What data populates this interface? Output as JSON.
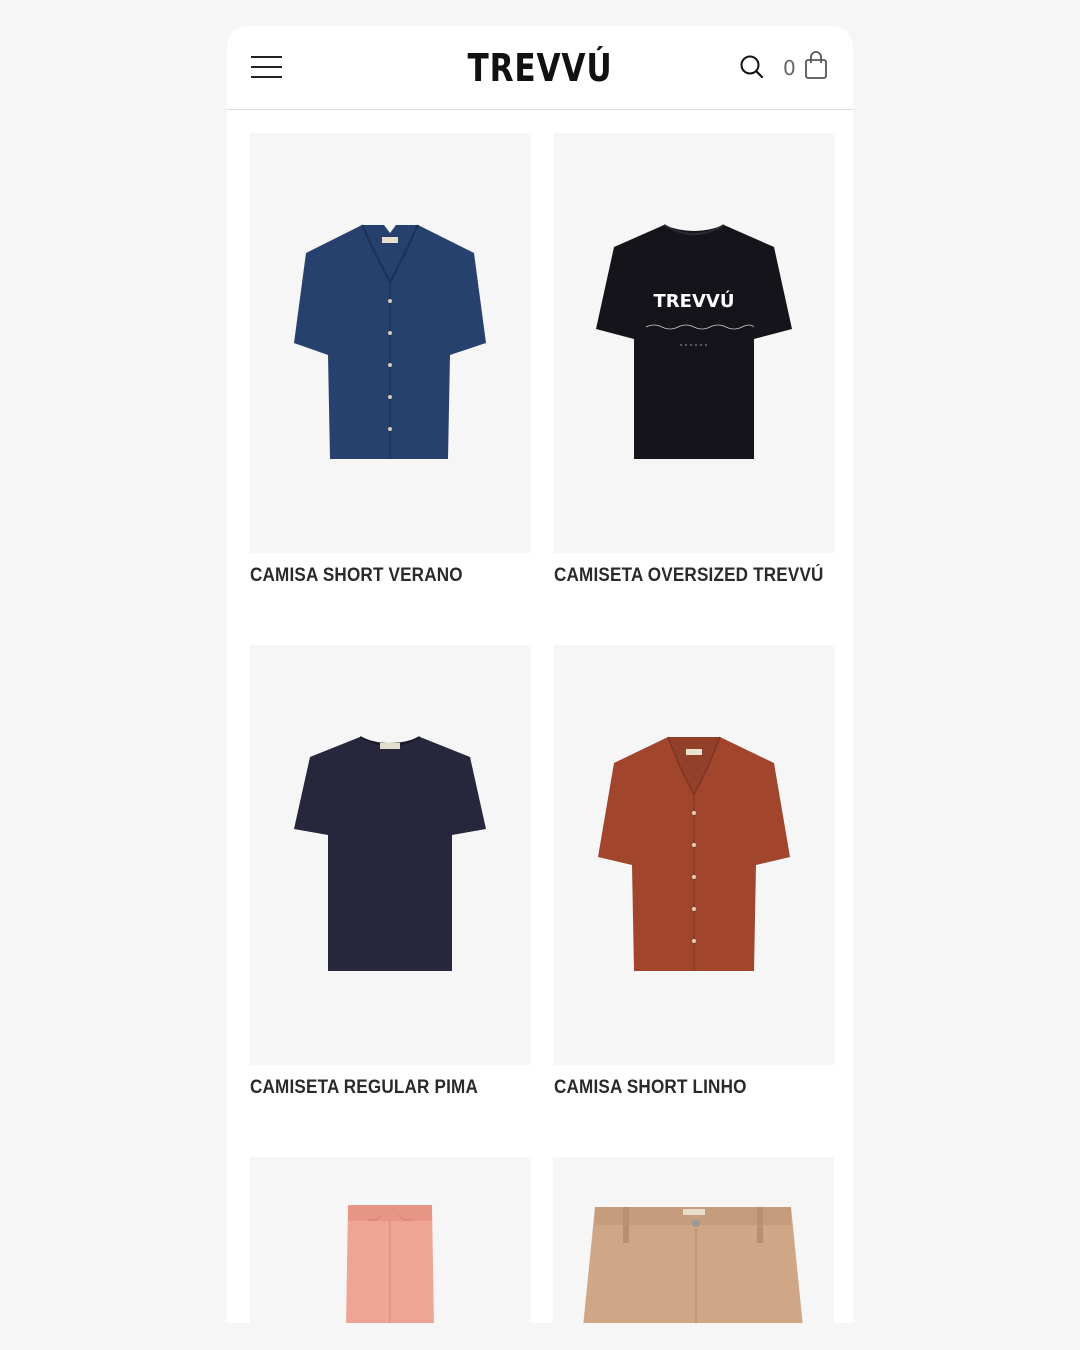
{
  "header": {
    "brand": "TREVVÚ",
    "cart_count": "0"
  },
  "products": [
    {
      "name": "CAMISA SHORT VERANO",
      "color": "#27416e"
    },
    {
      "name": "CAMISETA OVERSIZED TREVVÚ",
      "color": "#15141a",
      "print_brand": "TREVVÚ"
    },
    {
      "name": "CAMISETA REGULAR PIMA",
      "color": "#26263d"
    },
    {
      "name": "CAMISA SHORT LINHO",
      "color": "#a1452c"
    },
    {
      "name": "",
      "color": "#efa596"
    },
    {
      "name": "",
      "color": "#cfa786"
    }
  ],
  "colors": {
    "page_bg": "#f6f6f6",
    "card_bg": "#f6f6f6",
    "text": "#2a2a2a"
  }
}
